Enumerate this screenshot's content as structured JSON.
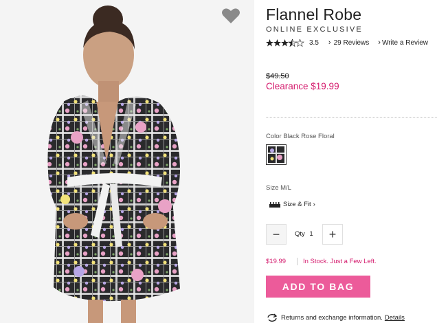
{
  "product": {
    "title": "Flannel Robe",
    "subtitle": "ONLINE EXCLUSIVE",
    "rating": 3.5,
    "rating_text": "3.5",
    "reviews_link": "29 Reviews",
    "write_review_link": "Write a Review",
    "was_price": "$49.50",
    "sale_price": "Clearance $19.99",
    "image_alt": "Model wearing black floral flannel robe"
  },
  "color": {
    "label": "Color",
    "value": "Black Rose Floral"
  },
  "size": {
    "label": "Size",
    "value": "M/L",
    "size_fit_link": "Size & Fit"
  },
  "quantity": {
    "label": "Qty",
    "value": "1",
    "minus": "−",
    "plus": "+"
  },
  "availability": {
    "price": "$19.99",
    "stock": "In Stock. Just a Few Left."
  },
  "actions": {
    "add_to_bag": "ADD TO BAG"
  },
  "returns": {
    "text": "Returns and exchange information.",
    "details_link": "Details"
  },
  "colors": {
    "accent": "#d4196c",
    "button": "#ec5b9a",
    "star": "#222222"
  },
  "icons": {
    "wishlist": "heart-icon",
    "size_fit": "ruler-icon",
    "returns": "return-arrows-icon",
    "chevron": "chevron-right-icon"
  }
}
